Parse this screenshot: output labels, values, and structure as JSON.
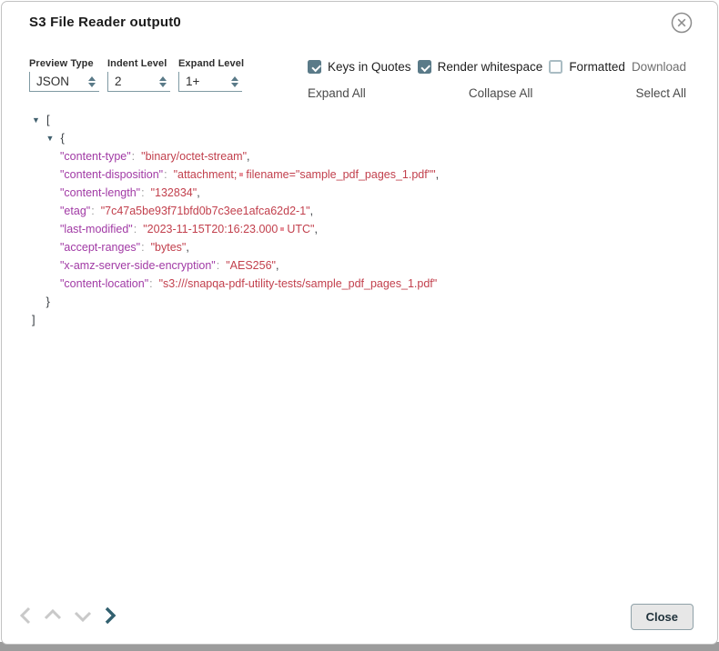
{
  "dialog": {
    "title": "S3 File Reader output0"
  },
  "controls": {
    "selects": [
      {
        "label": "Preview Type",
        "value": "JSON"
      },
      {
        "label": "Indent Level",
        "value": "2"
      },
      {
        "label": "Expand Level",
        "value": "1+"
      }
    ],
    "checkboxes": [
      {
        "label": "Keys in Quotes",
        "checked": true
      },
      {
        "label": "Render whitespace",
        "checked": true
      },
      {
        "label": "Formatted",
        "checked": false
      }
    ],
    "download_label": "Download",
    "links": [
      "Expand All",
      "Collapse All",
      "Select All"
    ]
  },
  "json_tree": {
    "lines": [
      {
        "kind": "open",
        "indent": 0,
        "bracket": "["
      },
      {
        "kind": "open",
        "indent": 1,
        "bracket": "{"
      },
      {
        "kind": "pair",
        "indent": 2,
        "key": "content-type",
        "value_parts": [
          "binary/octet-stream"
        ],
        "comma": true
      },
      {
        "kind": "pair",
        "indent": 2,
        "key": "content-disposition",
        "value_parts": [
          "attachment;",
          "filename=\"sample_pdf_pages_1.pdf\""
        ],
        "comma": true
      },
      {
        "kind": "pair",
        "indent": 2,
        "key": "content-length",
        "value_parts": [
          "132834"
        ],
        "comma": true
      },
      {
        "kind": "pair",
        "indent": 2,
        "key": "etag",
        "value_parts": [
          "7c47a5be93f71bfd0b7c3ee1afca62d2-1"
        ],
        "comma": true
      },
      {
        "kind": "pair",
        "indent": 2,
        "key": "last-modified",
        "value_parts": [
          "2023-11-15T20:16:23.000",
          "UTC"
        ],
        "comma": true
      },
      {
        "kind": "pair",
        "indent": 2,
        "key": "accept-ranges",
        "value_parts": [
          "bytes"
        ],
        "comma": true
      },
      {
        "kind": "pair",
        "indent": 2,
        "key": "x-amz-server-side-encryption",
        "value_parts": [
          "AES256"
        ],
        "comma": true
      },
      {
        "kind": "pair",
        "indent": 2,
        "key": "content-location",
        "value_parts": [
          "s3:///snapqa-pdf-utility-tests/sample_pdf_pages_1.pdf"
        ],
        "comma": false
      },
      {
        "kind": "close",
        "indent": 1,
        "bracket": "}"
      },
      {
        "kind": "close",
        "indent": 0,
        "bracket": "]"
      }
    ]
  },
  "footer": {
    "close_label": "Close"
  },
  "colors": {
    "accent": "#5a7a88",
    "select_border": "#7f9aa3",
    "json_key": "#a13aa5",
    "json_value": "#c2404d",
    "json_ws_marker": "#e9959e",
    "json_punct": "#3a3f44",
    "json_colon": "#999999",
    "tree_arrow": "#41606e",
    "nav_disabled": "#c9c9c9",
    "nav_active": "#32606f",
    "link": "#4a4a4a",
    "download": "#6e6e6e"
  }
}
